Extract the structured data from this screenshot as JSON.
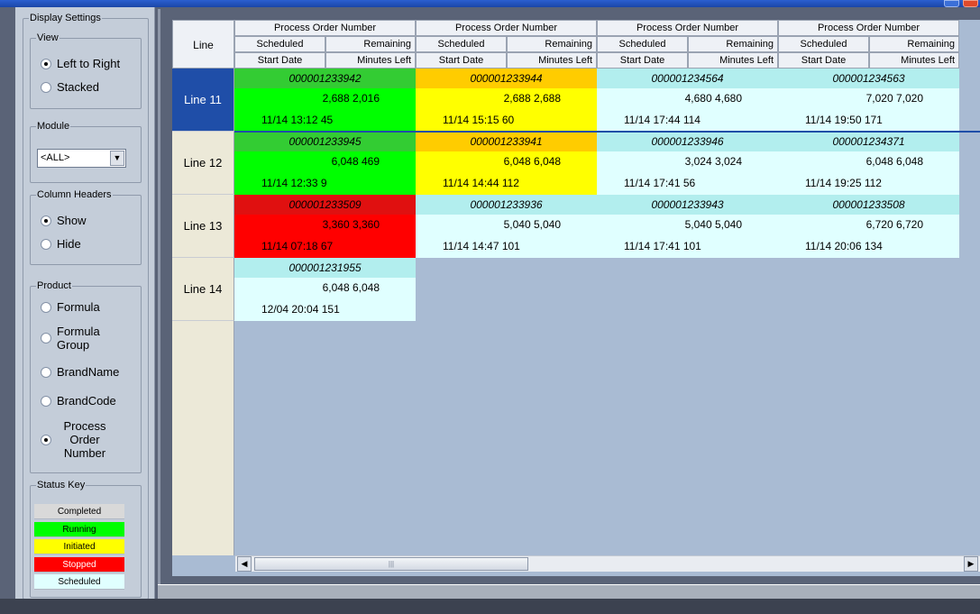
{
  "sidebar": {
    "display_settings_title": "Display Settings",
    "view": {
      "title": "View",
      "options": [
        {
          "label": "Left to Right",
          "selected": true
        },
        {
          "label": "Stacked",
          "selected": false
        }
      ]
    },
    "module": {
      "title": "Module",
      "value": "<ALL>"
    },
    "column_headers": {
      "title": "Column Headers",
      "options": [
        {
          "label": "Show",
          "selected": true
        },
        {
          "label": "Hide",
          "selected": false
        }
      ]
    },
    "product": {
      "title": "Product",
      "options": [
        {
          "label": "Formula",
          "selected": false
        },
        {
          "label": "Formula Group",
          "selected": false
        },
        {
          "label": "BrandName",
          "selected": false
        },
        {
          "label": "BrandCode",
          "selected": false
        },
        {
          "label": "Process Order Number",
          "selected": true
        }
      ]
    },
    "status_key": {
      "title": "Status Key",
      "items": [
        {
          "label": "Completed",
          "color": "#d9d9d9",
          "text_color": "#000000"
        },
        {
          "label": "Running",
          "color": "#00ff00",
          "text_color": "#000000"
        },
        {
          "label": "Initiated",
          "color": "#ffff00",
          "text_color": "#000000"
        },
        {
          "label": "Stopped",
          "color": "#ff0000",
          "text_color": "#ffffff"
        },
        {
          "label": "Scheduled",
          "color": "#e0ffff",
          "text_color": "#000000"
        }
      ]
    }
  },
  "grid": {
    "line_header": "Line",
    "group_header": "Process Order Number",
    "sub_header_1": {
      "a": "Scheduled",
      "b": "Remaining"
    },
    "sub_header_2": {
      "a": "Start Date",
      "b": "Minutes Left"
    },
    "group_count": 4,
    "rows": [
      {
        "line": "Line 11",
        "selected": true,
        "cells": [
          {
            "order": "000001233942",
            "status": "running",
            "qty": "2,688 2,016",
            "date": "11/14 13:12 45"
          },
          {
            "order": "000001233944",
            "status": "initiated",
            "qty": "2,688 2,688",
            "date": "11/14 15:15 60"
          },
          {
            "order": "000001234564",
            "status": "scheduled",
            "qty": "4,680 4,680",
            "date": "11/14 17:44 114"
          },
          {
            "order": "000001234563",
            "status": "scheduled",
            "qty": "7,020 7,020",
            "date": "11/14 19:50 171"
          }
        ]
      },
      {
        "line": "Line 12",
        "selected": false,
        "cells": [
          {
            "order": "000001233945",
            "status": "running",
            "qty": "6,048 469",
            "date": "11/14 12:33 9"
          },
          {
            "order": "000001233941",
            "status": "initiated",
            "qty": "6,048 6,048",
            "date": "11/14 14:44 112"
          },
          {
            "order": "000001233946",
            "status": "scheduled",
            "qty": "3,024 3,024",
            "date": "11/14 17:41 56"
          },
          {
            "order": "000001234371",
            "status": "scheduled",
            "qty": "6,048 6,048",
            "date": "11/14 19:25 112"
          }
        ]
      },
      {
        "line": "Line 13",
        "selected": false,
        "cells": [
          {
            "order": "000001233509",
            "status": "stopped",
            "qty": "3,360 3,360",
            "date": "11/14 07:18 67"
          },
          {
            "order": "000001233936",
            "status": "scheduled",
            "qty": "5,040 5,040",
            "date": "11/14 14:47 101"
          },
          {
            "order": "000001233943",
            "status": "scheduled",
            "qty": "5,040 5,040",
            "date": "11/14 17:41 101"
          },
          {
            "order": "000001233508",
            "status": "scheduled",
            "qty": "6,720 6,720",
            "date": "11/14 20:06 134"
          }
        ]
      },
      {
        "line": "Line 14",
        "selected": false,
        "cells": [
          {
            "order": "000001231955",
            "status": "scheduled",
            "qty": "6,048 6,048",
            "date": "12/04 20:04 151"
          }
        ]
      }
    ]
  },
  "status_colors": {
    "running": {
      "top": "#33cc33",
      "main": "#00ff00",
      "text": "#000000"
    },
    "initiated": {
      "top": "#ffcc00",
      "main": "#ffff00",
      "text": "#000000"
    },
    "stopped": {
      "top": "#e01010",
      "main": "#ff0000",
      "text": "#000000"
    },
    "scheduled": {
      "top": "#b2eeee",
      "main": "#e0ffff",
      "text": "#000000"
    }
  },
  "scrollbar": {
    "left_icon": "arrow-left-icon",
    "right_icon": "arrow-right-icon"
  }
}
